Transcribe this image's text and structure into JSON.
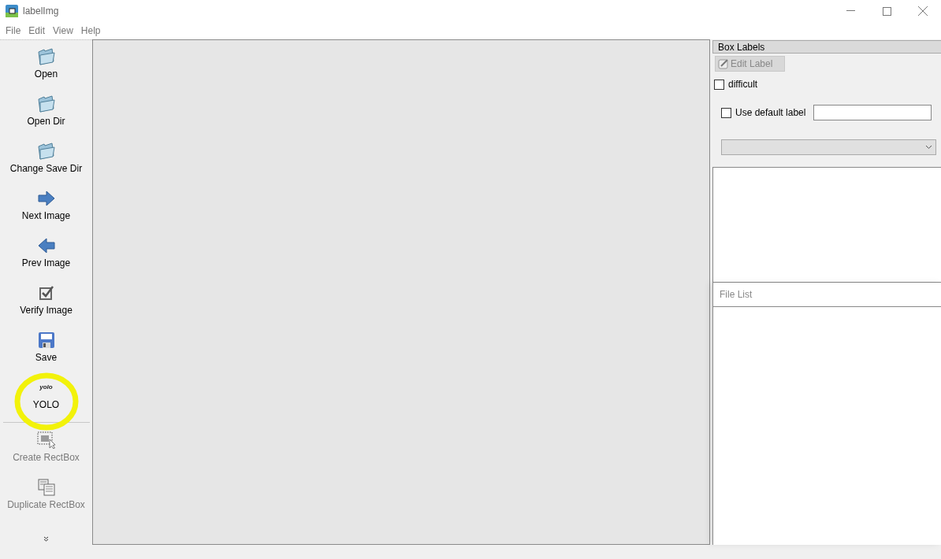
{
  "window": {
    "title": "labelImg"
  },
  "menu": [
    "File",
    "Edit",
    "View",
    "Help"
  ],
  "tools": [
    {
      "kind": "folder",
      "label": "Open",
      "disabled": false
    },
    {
      "kind": "folder",
      "label": "Open Dir",
      "disabled": false
    },
    {
      "kind": "folder",
      "label": "Change Save Dir",
      "disabled": false
    },
    {
      "kind": "next",
      "label": "Next Image",
      "disabled": false
    },
    {
      "kind": "prev",
      "label": "Prev Image",
      "disabled": false
    },
    {
      "kind": "verify",
      "label": "Verify Image",
      "disabled": false
    },
    {
      "kind": "save",
      "label": "Save",
      "disabled": false
    },
    {
      "kind": "format",
      "label": "YOLO",
      "icon_text": "yolo",
      "disabled": false,
      "highlighted": true
    },
    {
      "kind": "separator"
    },
    {
      "kind": "rect",
      "label": "Create RectBox",
      "disabled": true
    },
    {
      "kind": "duplicate",
      "label": "Duplicate RectBox",
      "disabled": true
    }
  ],
  "box_labels": {
    "title": "Box Labels",
    "edit_button": {
      "label": "Edit Label",
      "disabled": true
    },
    "difficult": {
      "label": "difficult",
      "checked": false
    },
    "default_label": {
      "label": "Use default label",
      "checked": false
    }
  },
  "file_list": {
    "title": "File List"
  }
}
